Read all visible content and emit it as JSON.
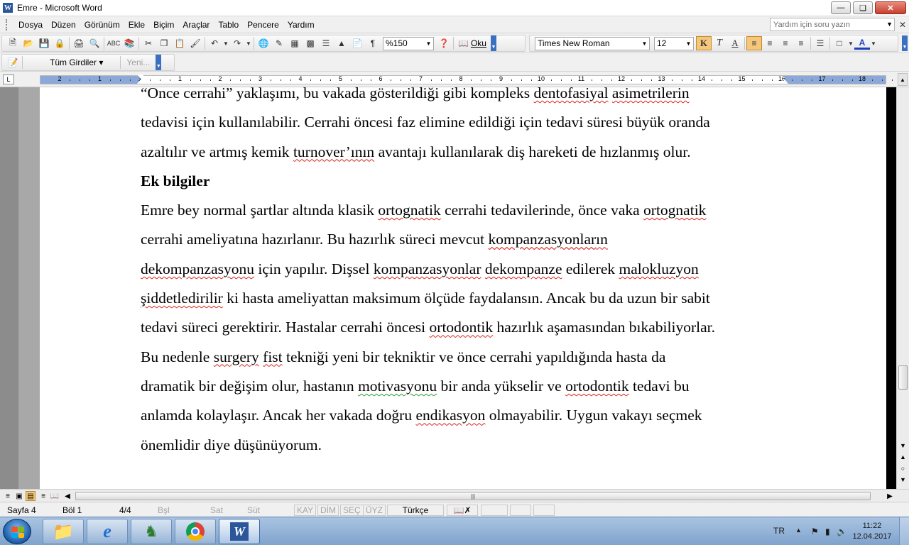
{
  "window": {
    "title": "Emre - Microsoft Word",
    "app_icon": "W"
  },
  "menu": {
    "items": [
      "Dosya",
      "Düzen",
      "Görünüm",
      "Ekle",
      "Biçim",
      "Araçlar",
      "Tablo",
      "Pencere",
      "Yardım"
    ],
    "help_placeholder": "Yardım için soru yazın"
  },
  "toolbar": {
    "zoom": "%150",
    "read_label": "Oku",
    "font_name": "Times New Roman",
    "font_size": "12",
    "bold_label": "K",
    "italic_label": "T",
    "font_color_label": "A",
    "review_all": "Tüm Girdiler",
    "review_new": "Yeni..."
  },
  "ruler": {
    "labels": [
      "2",
      "1",
      "1",
      "1",
      "2",
      "3",
      "4",
      "5",
      "6",
      "7",
      "8",
      "9",
      "10",
      "11",
      "12",
      "13",
      "14",
      "15",
      "16",
      "17",
      "18"
    ]
  },
  "document": {
    "lines": [
      {
        "type": "text",
        "html": "“Önce cerrahi” yaklaşımı, bu vakada gösterildiği gibi kompleks dentofasiyal  asimetrilerin"
      },
      {
        "type": "text",
        "html": "tedavisi için kullanılabilir. Cerrahi öncesi faz elimine edildiği için tedavi süresi büyük oranda"
      },
      {
        "type": "text",
        "html": "azaltılır ve artmış kemik turnover’ının avantajı kullanılarak diş hareketi de hızlanmış olur."
      },
      {
        "type": "heading",
        "html": "Ek bilgiler"
      },
      {
        "type": "text",
        "html": "Emre bey normal şartlar altında klasik ortognatik cerrahi tedavilerinde, önce vaka ortognatik"
      },
      {
        "type": "text",
        "html": "cerrahi ameliyatına hazırlanır. Bu hazırlık süreci mevcut kompanzasyonların"
      },
      {
        "type": "text",
        "html": "dekompanzasyonu için yapılır. Dişsel kompanzasyonlar dekompanze edilerek malokluzyon"
      },
      {
        "type": "text",
        "html": "şiddetledirilir ki hasta ameliyattan maksimum ölçüde faydalansın. Ancak bu da uzun bir sabit"
      },
      {
        "type": "text",
        "html": "tedavi süreci gerektirir. Hastalar cerrahi öncesi ortodontik hazırlık aşamasından bıkabiliyorlar."
      },
      {
        "type": "text",
        "html": "Bu nedenle surgery fist tekniği yeni bir tekniktir ve önce cerrahi yapıldığında hasta da"
      },
      {
        "type": "text",
        "html": "dramatik bir değişim olur, hastanın motivasyonu bir anda yükselir ve ortodontik tedavi bu"
      },
      {
        "type": "text",
        "html": "anlamda kolaylaşır. Ancak her vakada doğru endikasyon olmayabilir. Uygun vakayı seçmek"
      },
      {
        "type": "text",
        "html": "önemlidir diye düşünüyorum."
      }
    ],
    "squiggle_words": [
      "dentofasiyal",
      "asimetrilerin",
      "turnover’ının",
      "ortognatik",
      "kompanzasyonların",
      "dekompanzasyonu",
      "kompanzasyonlar",
      "dekompanze",
      "malokluzyon",
      "şiddetledirilir",
      "ortodontik",
      "surgery",
      "fist",
      "endikasyon"
    ],
    "grammar_words": [
      "motivasyonu"
    ]
  },
  "status": {
    "page": "Sayfa  4",
    "section": "Böl  1",
    "page_of": "4/4",
    "at": "Bşl",
    "line": "Sat",
    "col": "Süt",
    "rec": "KAY",
    "trk": "DİM",
    "ext": "SEÇ",
    "ovr": "ÜYZ",
    "language": "Türkçe"
  },
  "taskbar": {
    "language": "TR",
    "time": "11:22",
    "date": "12.04.2017"
  }
}
